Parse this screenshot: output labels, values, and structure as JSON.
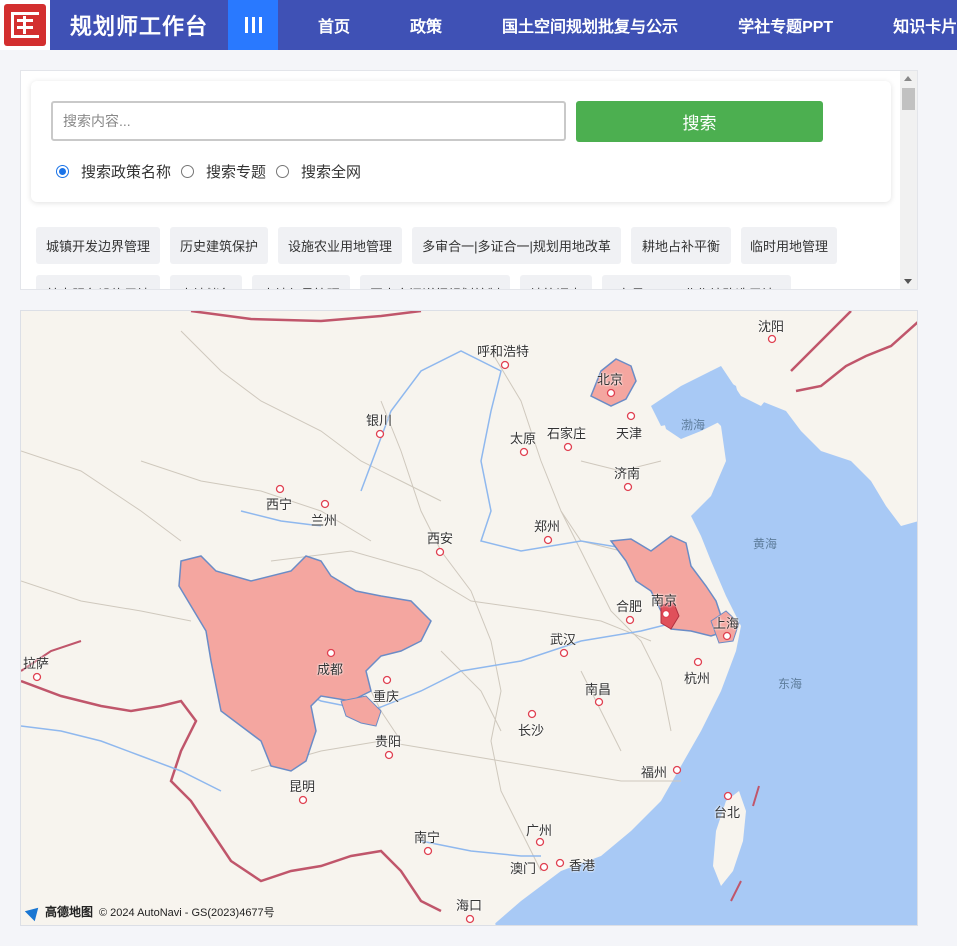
{
  "header": {
    "brand": "规划师工作台",
    "nav": [
      "首页",
      "政策",
      "国土空间规划批复与公示",
      "学社专题PPT",
      "知识卡片"
    ]
  },
  "search": {
    "placeholder": "搜索内容...",
    "button": "搜索",
    "options": [
      "搜索政策名称",
      "搜索专题",
      "搜索全网"
    ],
    "selected": "搜索政策名称"
  },
  "tags": [
    "城镇开发边界管理",
    "历史建筑保护",
    "设施农业用地管理",
    "多审合一|多证合一|规划用地改革",
    "耕地占补平衡",
    "临时用地管理",
    "基本服务设施用地",
    "土地储备",
    "土地复垦管理",
    "国土空间详细规划编制",
    "地籍调查",
    "存量——工业作坊改造用地"
  ],
  "map": {
    "cities": [
      "沈阳",
      "呼和浩特",
      "北京",
      "天津",
      "银川",
      "太原",
      "石家庄",
      "济南",
      "西宁",
      "兰州",
      "郑州",
      "西安",
      "南京",
      "合肥",
      "上海",
      "成都",
      "武汉",
      "拉萨",
      "重庆",
      "杭州",
      "南昌",
      "长沙",
      "贵阳",
      "福州",
      "昆明",
      "台北",
      "广州",
      "南宁",
      "澳门",
      "香港",
      "海口"
    ],
    "seas": [
      "渤海",
      "黄海",
      "东海"
    ],
    "attribution_logo": "高德地图",
    "attribution": "© 2024 AutoNavi - GS(2023)4677号",
    "colors": {
      "highlight": "#f4a6a0",
      "sea": "#a8c9f5",
      "land": "#f7f4ee",
      "border": "#c0566b"
    }
  }
}
